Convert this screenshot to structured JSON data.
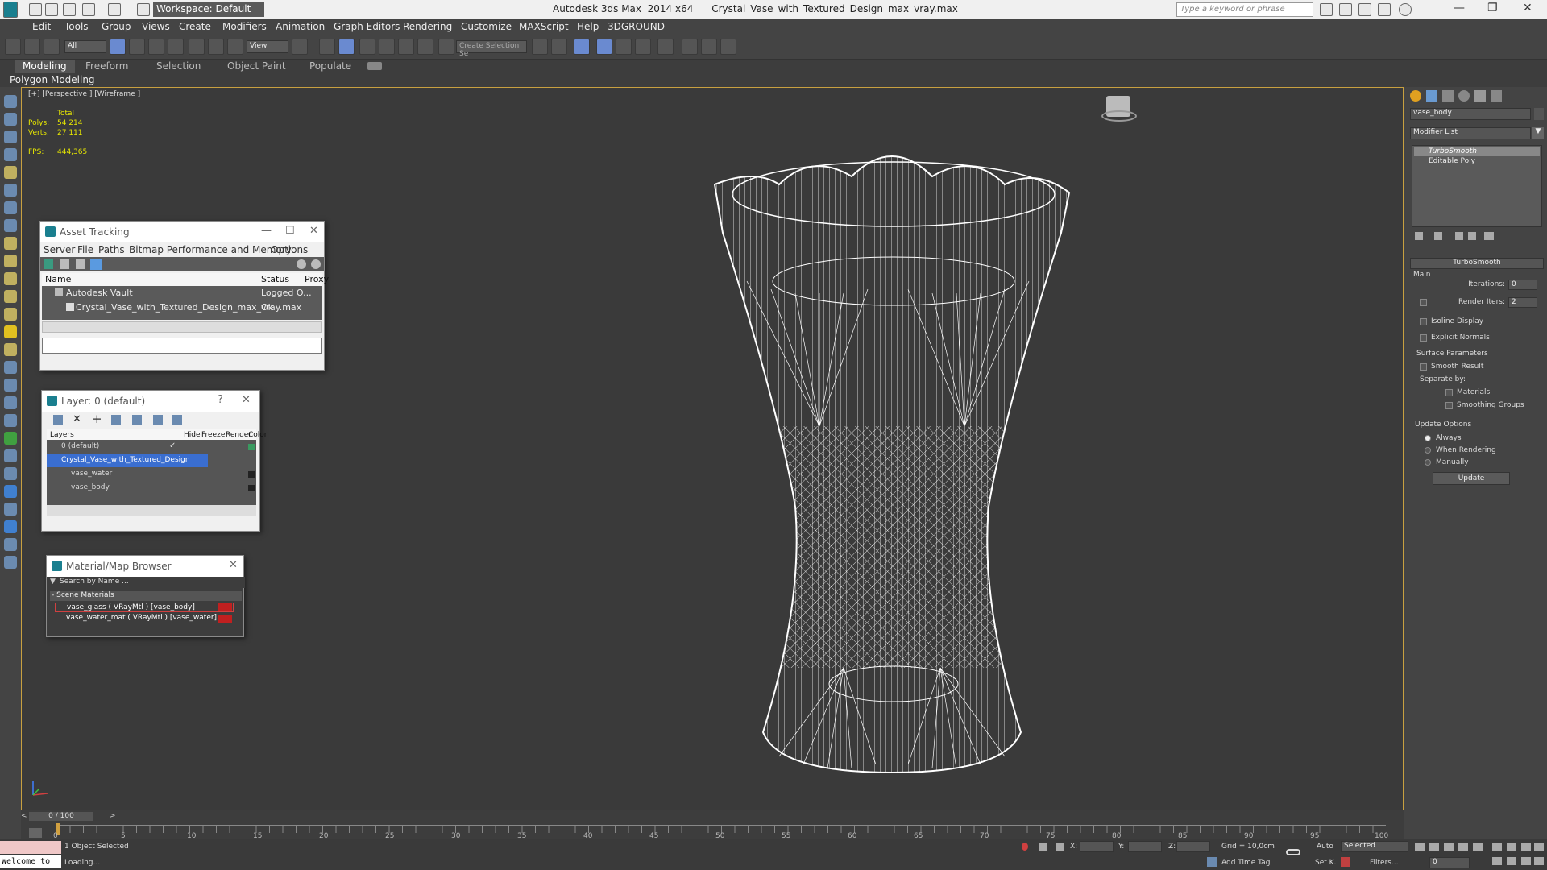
{
  "titlebar": {
    "app_title": "Autodesk 3ds Max  2014 x64      Crystal_Vase_with_Textured_Design_max_vray.max",
    "workspace": "Workspace: Default",
    "search_placeholder": "Type a keyword or phrase"
  },
  "menu": [
    "Edit",
    "Tools",
    "Group",
    "Views",
    "Create",
    "Modifiers",
    "Animation",
    "Graph Editors",
    "Rendering",
    "Customize",
    "MAXScript",
    "Help",
    "3DGROUND"
  ],
  "toolbar": {
    "filter": "All",
    "ref_coord": "View",
    "selection_set": "Create Selection Se"
  },
  "ribbon": {
    "tabs": [
      "Modeling",
      "Freeform",
      "Selection",
      "Object Paint",
      "Populate"
    ],
    "active_tab": "Modeling",
    "sub_label": "Polygon Modeling"
  },
  "viewport": {
    "label": "[+] [Perspective ] [Wireframe ]",
    "stats_total": "Total",
    "polys_label": "Polys:",
    "polys_value": "54 214",
    "verts_label": "Verts:",
    "verts_value": "27 111",
    "fps_label": "FPS:",
    "fps_value": "444,365"
  },
  "asset_tracking": {
    "title": "Asset Tracking",
    "menu": [
      "Server",
      "File",
      "Paths",
      "Bitmap Performance and Memory",
      "Options"
    ],
    "columns": [
      "Name",
      "Status",
      "Proxy"
    ],
    "rows": [
      {
        "name": "Autodesk Vault",
        "status": "Logged O..."
      },
      {
        "name": "Crystal_Vase_with_Textured_Design_max_vray.max",
        "status": "Ok"
      }
    ]
  },
  "layer_panel": {
    "title": "Layer: 0 (default)",
    "help": "?",
    "columns": [
      "Layers",
      "Hide",
      "Freeze",
      "Render",
      "Color"
    ],
    "rows": [
      {
        "name": "0 (default)"
      },
      {
        "name": "Crystal_Vase_with_Textured_Design"
      },
      {
        "name": "vase_water"
      },
      {
        "name": "vase_body"
      }
    ]
  },
  "material_browser": {
    "title": "Material/Map Browser",
    "search_placeholder": "Search by Name ...",
    "section": "- Scene Materials",
    "items": [
      "vase_glass  ( VRayMtl ) [vase_body]",
      "vase_water_mat  ( VRayMtl ) [vase_water]"
    ]
  },
  "command_panel": {
    "object_name": "vase_body",
    "modifier_list": "Modifier List",
    "stack": [
      "TurboSmooth",
      "Editable Poly"
    ],
    "rollout_title": "TurboSmooth",
    "main": "Main",
    "iterations_label": "Iterations:",
    "iterations_value": "0",
    "render_iters_label": "Render Iters:",
    "render_iters_value": "2",
    "isoline": "Isoline Display",
    "explicit_normals": "Explicit Normals",
    "surface_params": "Surface Parameters",
    "smooth_result": "Smooth Result",
    "separate_by": "Separate by:",
    "materials": "Materials",
    "smoothing_groups": "Smoothing Groups",
    "update_options": "Update Options",
    "always": "Always",
    "when_rendering": "When Rendering",
    "manually": "Manually",
    "update_button": "Update"
  },
  "timeline": {
    "frame": "0 / 100",
    "ticks": [
      "0",
      "5",
      "10",
      "15",
      "20",
      "25",
      "30",
      "35",
      "40",
      "45",
      "50",
      "55",
      "60",
      "65",
      "70",
      "75",
      "80",
      "85",
      "90",
      "95",
      "100"
    ]
  },
  "statusbar": {
    "listener": "Welcome to",
    "selected": "1 Object Selected",
    "loading": "Loading...",
    "x_label": "X:",
    "y_label": "Y:",
    "z_label": "Z:",
    "grid": "Grid = 10,0cm",
    "add_time_tag": "Add Time Tag",
    "auto": "Auto",
    "selected_dropdown": "Selected",
    "set_key": "Set K.",
    "filters": "Filters...",
    "frame_value": "0"
  }
}
